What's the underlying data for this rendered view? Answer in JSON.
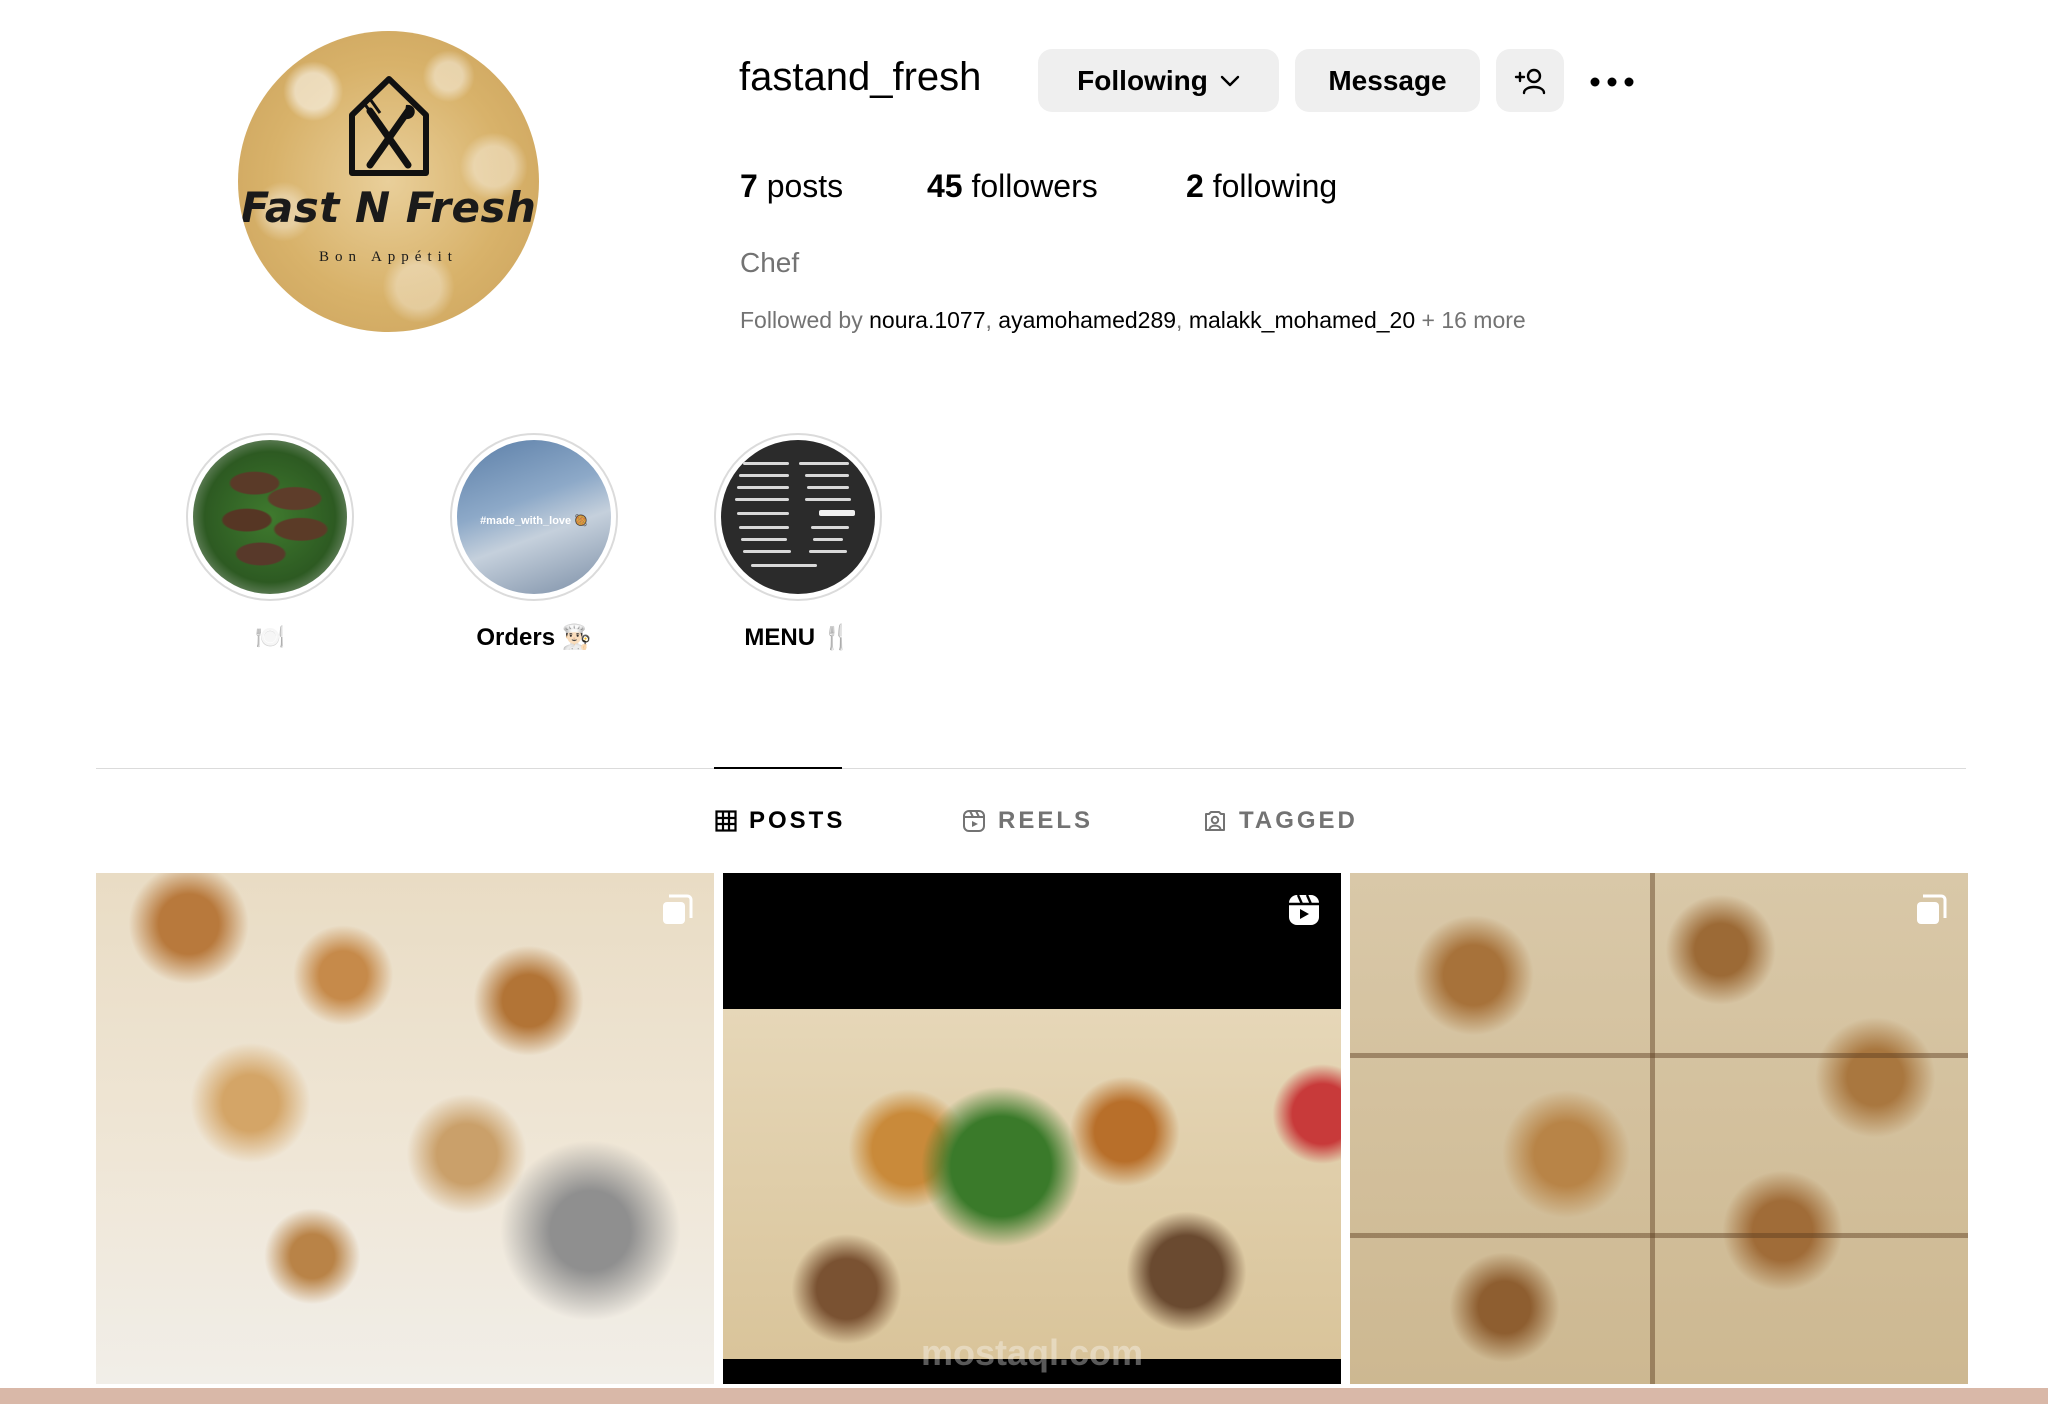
{
  "profile": {
    "username": "fastand_fresh",
    "avatar": {
      "brand": "Fast N Fresh",
      "tagline": "Bon Appétit",
      "logo_icon": "house-fork-knife-icon"
    },
    "buttons": {
      "following": "Following",
      "message": "Message",
      "add_user_icon": "add-user-icon",
      "more_icon": "more-options-icon"
    },
    "stats": {
      "posts_count": "7",
      "posts_label": "posts",
      "followers_count": "45",
      "followers_label": "followers",
      "following_count": "2",
      "following_label": "following"
    },
    "bio": "Chef",
    "followed_by": {
      "prefix": "Followed by ",
      "users": [
        "noura.1077",
        "ayamohamed289",
        "malakk_mohamed_20"
      ],
      "suffix": " + 16 more"
    }
  },
  "highlights": [
    {
      "label": "🍽️"
    },
    {
      "label": "Orders 👨🏻‍🍳",
      "caption": "#made_with_love 🥘"
    },
    {
      "label": "MENU 🍴"
    }
  ],
  "tabs": [
    {
      "label": "POSTS",
      "icon": "grid-icon",
      "active": true
    },
    {
      "label": "REELS",
      "icon": "reels-icon",
      "active": false
    },
    {
      "label": "TAGGED",
      "icon": "tagged-icon",
      "active": false
    }
  ],
  "posts": [
    {
      "badge_icon": "carousel-icon"
    },
    {
      "badge_icon": "reels-icon",
      "watermark": "mostaql.com"
    },
    {
      "badge_icon": "carousel-icon"
    }
  ],
  "colors": {
    "button_bg": "#efefef",
    "secondary_text": "#737373",
    "divider": "#dbdbdb"
  }
}
